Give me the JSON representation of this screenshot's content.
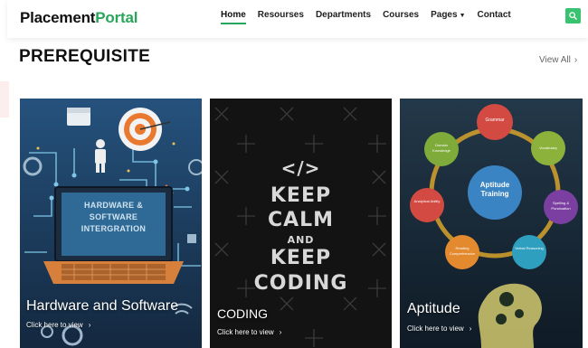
{
  "navbar": {
    "brand_main": "Placement",
    "brand_accent": "Portal",
    "links": [
      {
        "label": "Home",
        "active": true
      },
      {
        "label": "Resourses"
      },
      {
        "label": "Departments"
      },
      {
        "label": "Courses"
      },
      {
        "label": "Pages"
      },
      {
        "label": "Contact"
      }
    ],
    "search_icon": "search-icon",
    "accent_color": "#2aa65c"
  },
  "section": {
    "title": "PREREQUISITE",
    "view_all": "View All"
  },
  "cards": [
    {
      "title": "Hardware and Software",
      "link": "Click here to view",
      "image_text": "HARDWARE & SOFTWARE INTERGRATION"
    },
    {
      "title": "CODING",
      "link": "Click here to view",
      "image_text": [
        "</>",
        "KEEP",
        "CALM",
        "AND",
        "KEEP",
        "CODING"
      ]
    },
    {
      "title": "Aptitude",
      "link": "Click here to view",
      "image_text": {
        "center": "Aptitude Training",
        "nodes": [
          "Grammar",
          "Vocabulary",
          "Spelling & Punctuation",
          "Verbal Reasoning",
          "Reading Comprehension",
          "Analytical Ability",
          "Domain Knowledge"
        ]
      }
    }
  ]
}
